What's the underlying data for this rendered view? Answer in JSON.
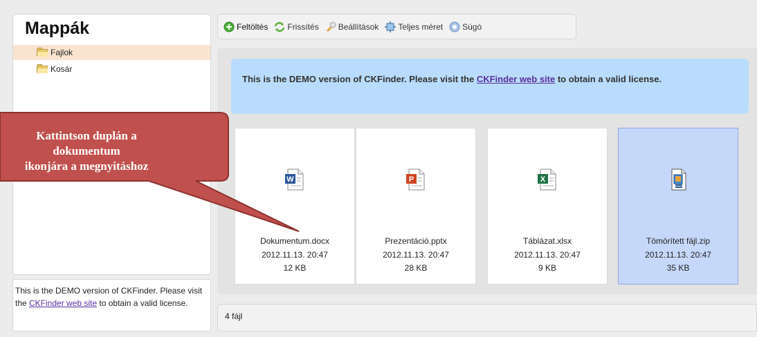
{
  "sidebar": {
    "title": "Mappák",
    "folders": [
      {
        "label": "Fajlok",
        "selected": true,
        "icon": "folder-icon"
      },
      {
        "label": "Kosár",
        "selected": false,
        "icon": "folder-icon"
      }
    ]
  },
  "demo_notice": {
    "text_before": "This is the DEMO version of CKFinder. Please visit the ",
    "link": "CKFinder web site",
    "text_after": " to obtain a valid license."
  },
  "toolbar": {
    "items": [
      {
        "label": "Feltöltés",
        "icon": "upload-icon"
      },
      {
        "label": "Frissítés",
        "icon": "refresh-icon"
      },
      {
        "label": "Beállítások",
        "icon": "settings-icon"
      },
      {
        "label": "Teljes méret",
        "icon": "fullscreen-icon"
      },
      {
        "label": "Súgó",
        "icon": "help-icon"
      }
    ]
  },
  "banner": {
    "text_before": "This is the DEMO version of CKFinder. Please visit the ",
    "link": "CKFinder web site",
    "text_after": " to obtain a valid license."
  },
  "files": [
    {
      "name": "Dokumentum.docx",
      "date": "2012.11.13. 20:47",
      "size": "12 KB",
      "icon": "word-file-icon",
      "selected": false
    },
    {
      "name": "Prezentáció.pptx",
      "date": "2012.11.13. 20:47",
      "size": "28 KB",
      "icon": "powerpoint-file-icon",
      "selected": false
    },
    {
      "name": "Táblázat.xlsx",
      "date": "2012.11.13. 20:47",
      "size": "9 KB",
      "icon": "excel-file-icon",
      "selected": false
    },
    {
      "name": "Tömörített fájl.zip",
      "date": "2012.11.13. 20:47",
      "size": "35 KB",
      "icon": "zip-file-icon",
      "selected": true
    }
  ],
  "status": {
    "text": "4 fájl"
  },
  "callout": {
    "line1": "Kattintson duplán a",
    "line2": "dokumentum",
    "line3": "ikonjára a megnyitáshoz",
    "color": "#c0504d"
  },
  "colors": {
    "banner_bg": "#b9dcfc",
    "selected_folder": "#f8e4cf",
    "selected_file": "#c6d8f9",
    "link": "#5a2ea1"
  }
}
